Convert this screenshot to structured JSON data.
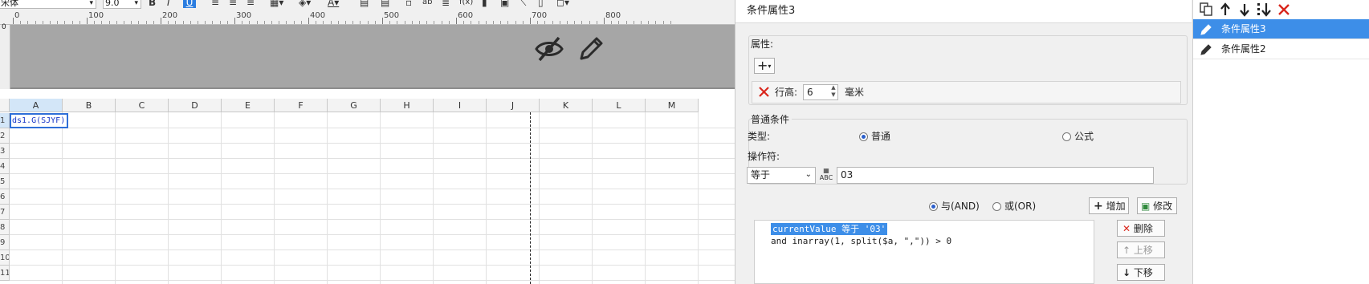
{
  "toolbar": {
    "font_family": "宋体",
    "font_size": "9.0",
    "bold": "B",
    "italic": "I",
    "underline": "U"
  },
  "ruler": {
    "marks": [
      "0",
      "100",
      "200",
      "300",
      "400",
      "500",
      "600",
      "700",
      "800"
    ]
  },
  "header_area": {
    "icons": [
      "eye-slash-icon",
      "pencil-icon"
    ]
  },
  "grid": {
    "columns": [
      "A",
      "B",
      "C",
      "D",
      "E",
      "F",
      "G",
      "H",
      "I",
      "J",
      "K",
      "L",
      "M"
    ],
    "rows": [
      "1",
      "2",
      "3",
      "4",
      "5",
      "6",
      "7",
      "8",
      "9",
      "10",
      "11"
    ],
    "cell_a1": "ds1.G(SJYF)"
  },
  "dialog": {
    "title": "条件属性3",
    "property_section": "属性:",
    "add_button": "+",
    "row_height_label": "行高:",
    "row_height_value": "6",
    "row_height_unit": "毫米",
    "normal_condition_section": "普通条件",
    "type_label": "类型:",
    "type_normal": "普通",
    "type_formula": "公式",
    "type_selected": "普通",
    "operator_label": "操作符:",
    "operator_value": "等于",
    "value_input": "03",
    "logic_and": "与(AND)",
    "logic_or": "或(OR)",
    "logic_selected": "and",
    "add_condition_button": "增加",
    "modify_button": "修改",
    "delete_button": "删除",
    "move_up_button": "上移",
    "move_down_button": "下移",
    "expressions": [
      "currentValue 等于 '03'",
      "and inarray(1, split($a, \",\")) > 0"
    ]
  },
  "condition_list": {
    "toolbar_icons": [
      "copy-icon",
      "arrow-up-icon",
      "arrow-down-icon",
      "sort-down-icon",
      "delete-icon"
    ],
    "items": [
      {
        "label": "条件属性3",
        "selected": true
      },
      {
        "label": "条件属性2",
        "selected": false
      }
    ]
  },
  "colors": {
    "selection": "#3d8ee8",
    "cell_border": "#2f6fd8",
    "delete_red": "#d9261c",
    "header_gray": "#a6a6a6"
  }
}
